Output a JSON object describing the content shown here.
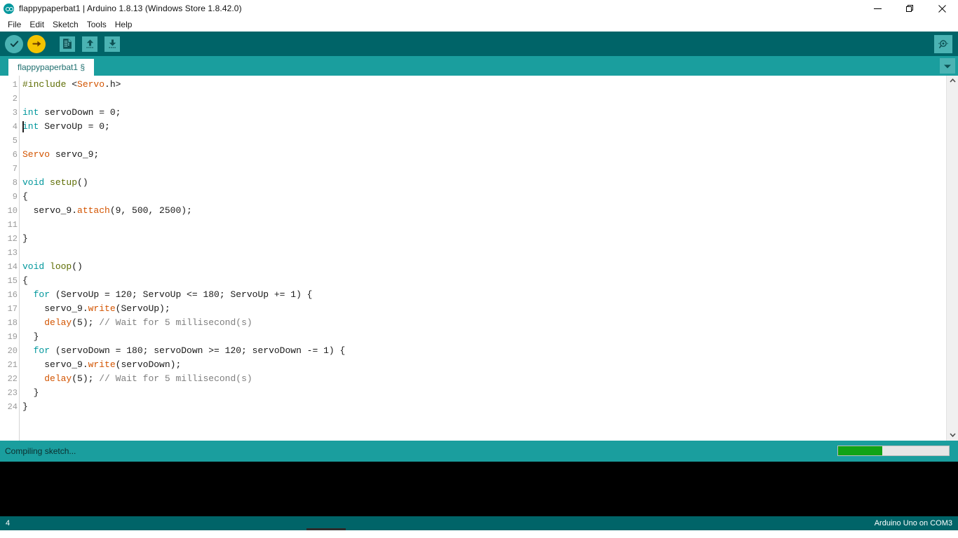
{
  "window": {
    "title": "flappypaperbat1 | Arduino 1.8.13 (Windows Store 1.8.42.0)",
    "logo_icon": "arduino-logo-icon",
    "controls": {
      "minimize": "minimize-icon",
      "restore": "restore-icon",
      "close": "close-icon"
    }
  },
  "menubar": {
    "items": [
      {
        "label": "File"
      },
      {
        "label": "Edit"
      },
      {
        "label": "Sketch"
      },
      {
        "label": "Tools"
      },
      {
        "label": "Help"
      }
    ]
  },
  "toolbar": {
    "buttons": [
      {
        "name": "verify-button",
        "icon": "check-icon",
        "tooltip": "Verify"
      },
      {
        "name": "upload-button",
        "icon": "arrow-right-icon",
        "tooltip": "Upload"
      },
      {
        "name": "new-button",
        "icon": "new-file-icon",
        "tooltip": "New"
      },
      {
        "name": "open-button",
        "icon": "arrow-up-icon",
        "tooltip": "Open"
      },
      {
        "name": "save-button",
        "icon": "arrow-down-icon",
        "tooltip": "Save"
      }
    ],
    "serial_monitor": {
      "name": "serial-monitor-button",
      "icon": "magnifier-icon",
      "tooltip": "Serial Monitor"
    }
  },
  "tabs": {
    "active": "flappypaperbat1 §",
    "items": [
      {
        "label": "flappypaperbat1 §"
      }
    ],
    "menu_icon": "chevron-down-icon"
  },
  "editor": {
    "cursor_line": 4,
    "total_lines": 24,
    "lines": [
      {
        "n": 1,
        "text": "#include <Servo.h>"
      },
      {
        "n": 2,
        "text": ""
      },
      {
        "n": 3,
        "text": "int servoDown = 0;"
      },
      {
        "n": 4,
        "text": "int ServoUp = 0;"
      },
      {
        "n": 5,
        "text": ""
      },
      {
        "n": 6,
        "text": "Servo servo_9;"
      },
      {
        "n": 7,
        "text": ""
      },
      {
        "n": 8,
        "text": "void setup()"
      },
      {
        "n": 9,
        "text": "{"
      },
      {
        "n": 10,
        "text": "  servo_9.attach(9, 500, 2500);"
      },
      {
        "n": 11,
        "text": ""
      },
      {
        "n": 12,
        "text": "}"
      },
      {
        "n": 13,
        "text": ""
      },
      {
        "n": 14,
        "text": "void loop()"
      },
      {
        "n": 15,
        "text": "{"
      },
      {
        "n": 16,
        "text": "  for (ServoUp = 120; ServoUp <= 180; ServoUp += 1) {"
      },
      {
        "n": 17,
        "text": "    servo_9.write(ServoUp);"
      },
      {
        "n": 18,
        "text": "    delay(5); // Wait for 5 millisecond(s)"
      },
      {
        "n": 19,
        "text": "  }"
      },
      {
        "n": 20,
        "text": "  for (servoDown = 180; servoDown >= 120; servoDown -= 1) {"
      },
      {
        "n": 21,
        "text": "    servo_9.write(servoDown);"
      },
      {
        "n": 22,
        "text": "    delay(5); // Wait for 5 millisecond(s)"
      },
      {
        "n": 23,
        "text": "  }"
      },
      {
        "n": 24,
        "text": "}"
      }
    ]
  },
  "scrollbar": {
    "up_icon": "chevron-up-icon",
    "down_icon": "chevron-down-icon"
  },
  "status": {
    "message": "Compiling sketch...",
    "progress_percent": 40
  },
  "bottombar": {
    "line_number": "4",
    "board_info": "Arduino Uno on COM3"
  },
  "colors": {
    "toolbar_dark_teal": "#006468",
    "tabbar_teal": "#1a9e9e",
    "accent_light_teal": "#4ab3b3",
    "upload_yellow": "#f5c400",
    "progress_green": "#11a314",
    "keyword": "#00979c",
    "type": "#d35400",
    "function": "#5e6d03",
    "comment": "#7e7e7e"
  }
}
